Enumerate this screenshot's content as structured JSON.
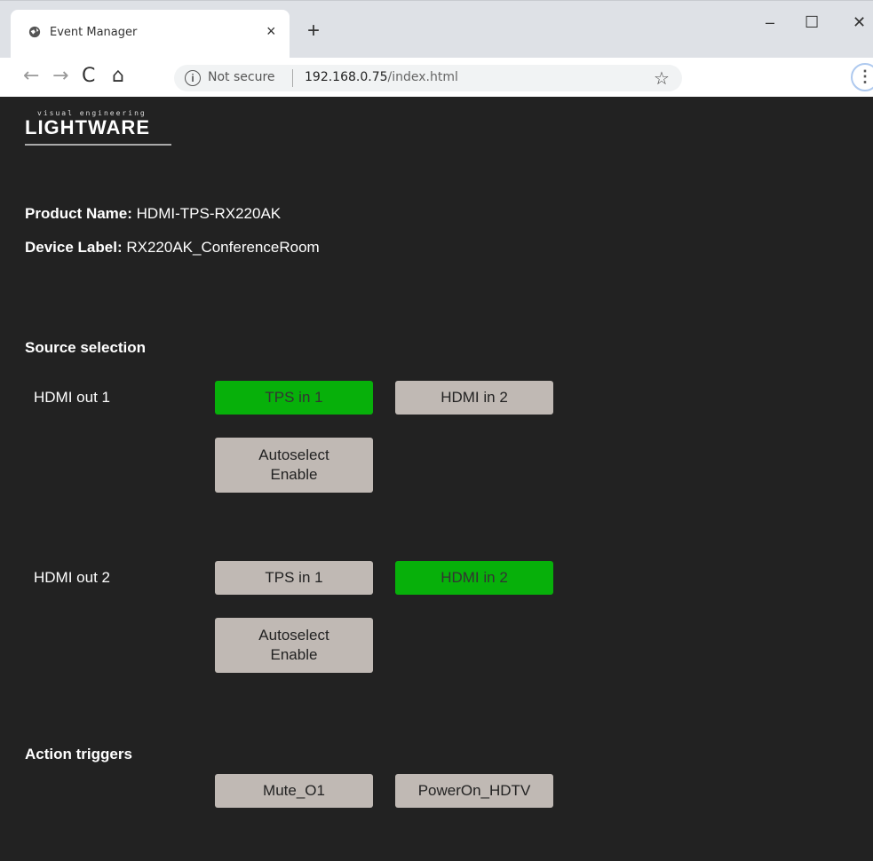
{
  "browser": {
    "tab_title": "Event Manager",
    "tab_close": "×",
    "new_tab": "+",
    "win_min": "–",
    "win_max": "☐",
    "win_close": "✕",
    "back": "←",
    "forward": "→",
    "reload": "C",
    "home": "⌂",
    "info_glyph": "i",
    "security": "Not secure",
    "url_host": "192.168.0.75",
    "url_path": "/index.html",
    "star": "☆",
    "menu": "⋮"
  },
  "logo": {
    "tagline": "visual engineering",
    "name": "LIGHTWARE"
  },
  "device": {
    "product_label": "Product Name:",
    "product_value": "HDMI-TPS-RX220AK",
    "device_label": "Device Label:",
    "device_value": "RX220AK_ConferenceRoom"
  },
  "source_selection": {
    "title": "Source selection",
    "outputs": [
      {
        "label": "HDMI out 1",
        "btn1": "TPS in 1",
        "btn2": "HDMI in 2",
        "autoselect": "Autoselect\nEnable",
        "active": "TPS in 1"
      },
      {
        "label": "HDMI out 2",
        "btn1": "TPS in 1",
        "btn2": "HDMI in 2",
        "autoselect": "Autoselect\nEnable",
        "active": "HDMI in 2"
      }
    ]
  },
  "action_triggers": {
    "title": "Action triggers",
    "buttons": [
      "Mute_O1",
      "PowerOn_HDTV"
    ]
  },
  "colors": {
    "active_button": "#07b00a",
    "button": "#c0b9b4",
    "background": "#222222"
  }
}
